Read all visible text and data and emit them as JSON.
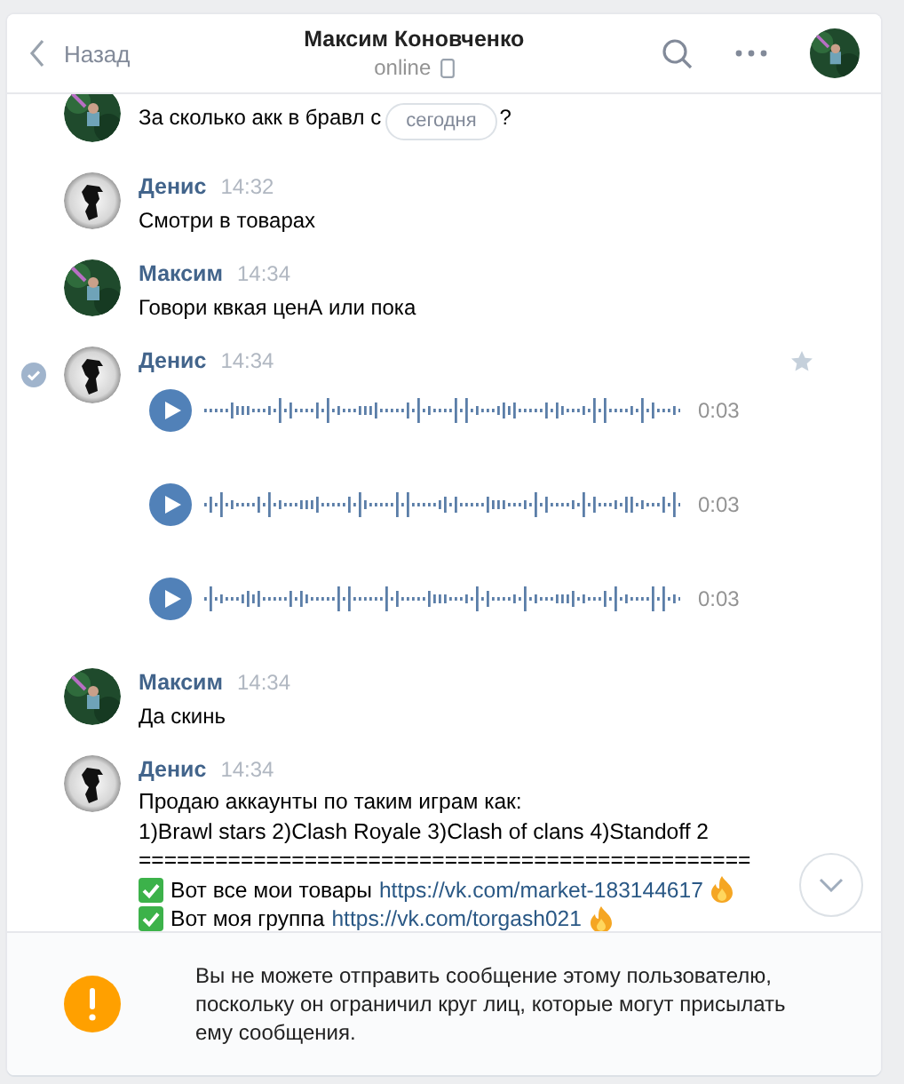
{
  "header": {
    "back": "Назад",
    "title": "Максим Коновченко",
    "status": "online"
  },
  "date_pill": "сегодня",
  "messages": [
    {
      "kind": "text",
      "avatar": {
        "kind": "picture"
      },
      "selected": false,
      "parts": [
        "За сколько акк в бравл с",
        "?"
      ]
    },
    {
      "kind": "text",
      "avatar": {
        "kind": "silhouette"
      },
      "selected": false,
      "name": "Денис",
      "time": "14:32",
      "lines": [
        "Смотри в товарах"
      ]
    },
    {
      "kind": "text",
      "avatar": {
        "kind": "picture"
      },
      "selected": false,
      "name": "Максим",
      "time": "14:34",
      "lines": [
        "Говори квкая ценА или пока"
      ]
    },
    {
      "kind": "voice",
      "avatar": {
        "kind": "silhouette"
      },
      "selected": true,
      "name": "Денис",
      "time": "14:34",
      "voices": [
        {
          "duration": "0:03"
        },
        {
          "duration": "0:03"
        },
        {
          "duration": "0:03"
        }
      ]
    },
    {
      "kind": "text",
      "avatar": {
        "kind": "picture"
      },
      "selected": false,
      "name": "Максим",
      "time": "14:34",
      "lines": [
        "Да скинь"
      ]
    },
    {
      "kind": "rich",
      "avatar": {
        "kind": "silhouette"
      },
      "selected": false,
      "name": "Денис",
      "time": "14:34",
      "lines": [
        {
          "kind": "plain",
          "text": "Продаю аккаунты по таким играм как:"
        },
        {
          "kind": "plain",
          "text": "1)Brawl stars 2)Clash Royale 3)Clash of clans 4)Standoff 2"
        },
        {
          "kind": "plain",
          "text": "================================================"
        },
        {
          "kind": "check-link",
          "text": "Вот все мои товары",
          "link": "https://vk.com/market-183144617"
        },
        {
          "kind": "check-link",
          "text": "Вот моя группа",
          "link": "https://vk.com/torgash021"
        }
      ]
    }
  ],
  "notice": "Вы не можете отправить сообщение этому пользователю, поскольку он ограничил круг лиц, которые могут присылать ему сообщения."
}
